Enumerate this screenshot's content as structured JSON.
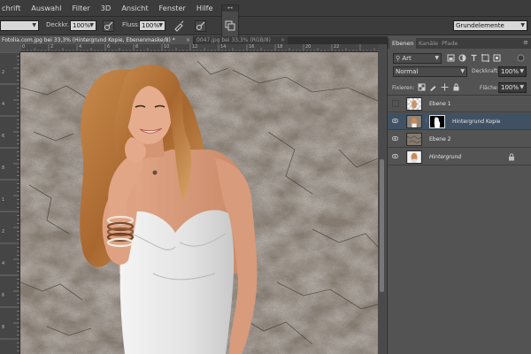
{
  "menu": [
    "chrift",
    "Auswahl",
    "Filter",
    "3D",
    "Ansicht",
    "Fenster",
    "Hilfe"
  ],
  "options": {
    "deckkraft_label": "Deckkr.:",
    "deckkraft_value": "100%",
    "fluss_label": "Fluss:",
    "fluss_value": "100%",
    "workspace": "Grundelemente"
  },
  "document_tabs": [
    {
      "label": "Fotolia.com.jpg bei 33,3% (Hintergrund Kopie, Ebenenmaske/8) *",
      "active": true
    },
    {
      "label": "0047.jpg bei 33,3% (RGB/8)",
      "active": false
    }
  ],
  "ruler_top_labels": [
    "0",
    "2",
    "4",
    "6",
    "8",
    "10",
    "12",
    "14",
    "16",
    "18",
    "20",
    "22"
  ],
  "ruler_left_labels": [
    "2",
    "4",
    "6",
    "8",
    "1",
    "2",
    "4",
    "6",
    "8"
  ],
  "panel": {
    "tabs": [
      "Ebenen",
      "Kanäle",
      "Pfade"
    ],
    "filter_kind": "Art",
    "blend_mode": "Normal",
    "opacity_label": "Deckkraft:",
    "opacity_value": "100%",
    "lock_label": "Fixieren:",
    "fill_label": "Fläche:",
    "fill_value": "100%"
  },
  "layers": [
    {
      "name": "Ebene 1",
      "visible": false,
      "has_mask": false,
      "selected": false,
      "italic": false,
      "locked": false
    },
    {
      "name": "Hintergrund Kopie",
      "visible": true,
      "has_mask": true,
      "selected": true,
      "italic": false,
      "locked": false
    },
    {
      "name": "Ebene 2",
      "visible": true,
      "has_mask": false,
      "selected": false,
      "italic": false,
      "locked": false
    },
    {
      "name": "Hintergrund",
      "visible": true,
      "has_mask": false,
      "selected": false,
      "italic": true,
      "locked": true
    }
  ],
  "colors": {
    "selection": "#3f5163",
    "menu_bg": "#3c3c3c",
    "panel_bg": "#535353",
    "stone_base": "#8e8378"
  }
}
